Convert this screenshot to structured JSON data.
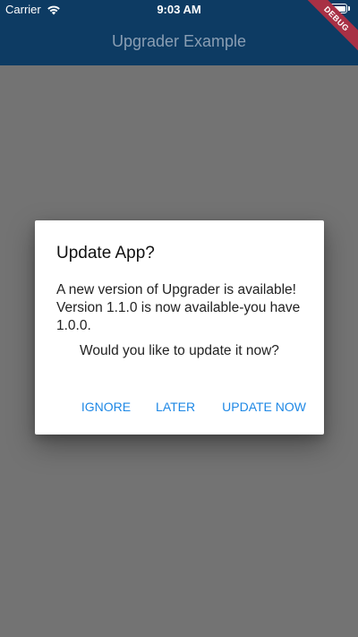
{
  "status_bar": {
    "carrier": "Carrier",
    "time": "9:03 AM",
    "wifi_icon": "wifi-icon",
    "battery_icon": "battery-icon",
    "text_color": "#ffffff"
  },
  "app_bar": {
    "title": "Upgrader Example",
    "background": "#0d3b63"
  },
  "debug_banner": {
    "label": "DEBUG",
    "color": "#a83045"
  },
  "dialog": {
    "title": "Update App?",
    "message": "A new version of Upgrader is available! Version 1.1.0 is now available-you have 1.0.0.",
    "prompt": "Would you like to update it now?",
    "buttons": {
      "ignore": "IGNORE",
      "later": "LATER",
      "update_now": "UPDATE NOW"
    },
    "accent_color": "#1e88e5"
  }
}
